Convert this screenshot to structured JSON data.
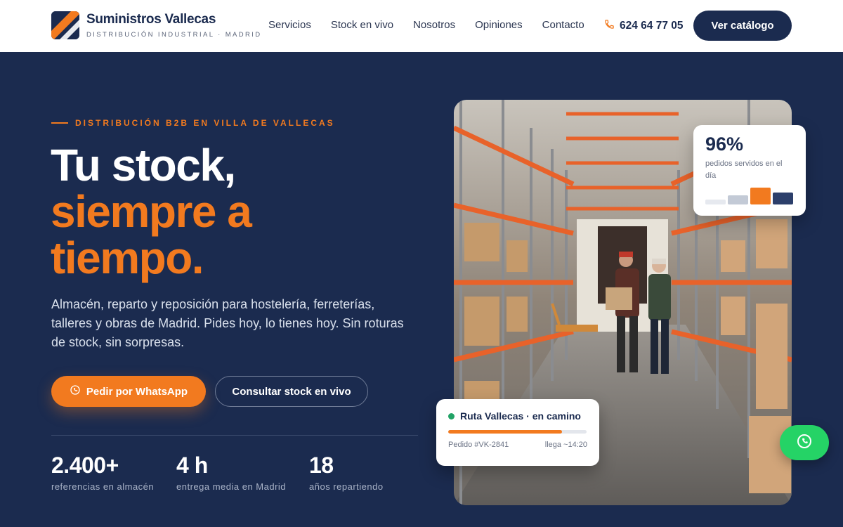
{
  "brand": {
    "name": "Suministros Vallecas",
    "tagline": "DISTRIBUCIÓN INDUSTRIAL · MADRID"
  },
  "nav": {
    "items": [
      {
        "label": "Servicios"
      },
      {
        "label": "Stock en vivo"
      },
      {
        "label": "Nosotros"
      },
      {
        "label": "Opiniones"
      },
      {
        "label": "Contacto"
      }
    ],
    "phone": "624 64 77 05",
    "cta": "Ver catálogo"
  },
  "hero": {
    "eyebrow": "DISTRIBUCIÓN B2B EN VILLA DE VALLECAS",
    "headline_white": "Tu stock,",
    "headline_orange_1": "siempre a",
    "headline_orange_2": "tiempo.",
    "lead": "Almacén, reparto y reposición para hostelería, ferreterías, talleres y obras de Madrid. Pides hoy, lo tienes hoy. Sin roturas de stock, sin sorpresas.",
    "btn_whatsapp": "Pedir por WhatsApp",
    "btn_stock": "Consultar stock en vivo",
    "stats": [
      {
        "value": "2.400+",
        "label": "referencias en almacén"
      },
      {
        "value": "4 h",
        "label": "entrega media en Madrid"
      },
      {
        "value": "18",
        "label": "años repartiendo"
      }
    ]
  },
  "rate_card": {
    "value": "96%",
    "caption": "pedidos servidos en el día",
    "bars": [
      0.3,
      0.55,
      1.0,
      0.72
    ]
  },
  "route_card": {
    "title": "Ruta Vallecas · en camino",
    "progress": 0.82,
    "order": "Pedido #VK-2841",
    "eta": "llega ~14:20"
  },
  "colors": {
    "navy": "#1b2b4f",
    "orange": "#f27a1f",
    "whatsapp": "#25d366",
    "status_green": "#21a366"
  },
  "icons": {
    "phone": "phone-icon",
    "whatsapp": "whatsapp-icon",
    "logo": "brand-logo-icon"
  }
}
